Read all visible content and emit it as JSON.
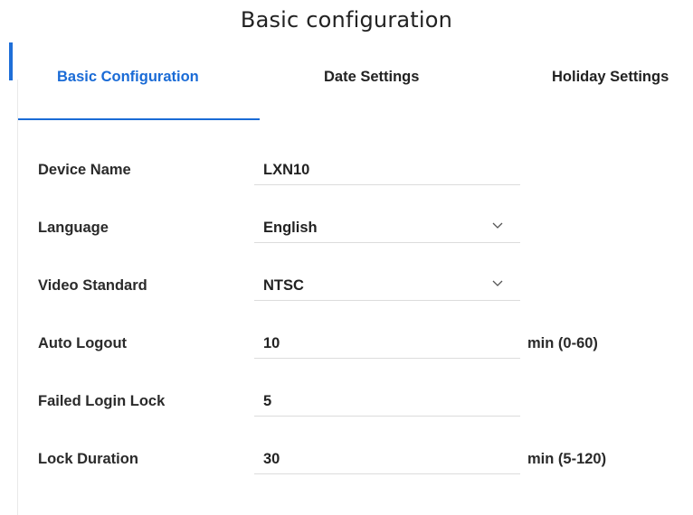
{
  "title": "Basic configuration",
  "tabs": [
    {
      "label": "Basic Configuration",
      "active": true
    },
    {
      "label": "Date Settings",
      "active": false
    },
    {
      "label": "Holiday Settings",
      "active": false
    }
  ],
  "colors": {
    "accent": "#1a6bd6",
    "text": "#222222",
    "divider": "#dcdcdc"
  },
  "form": {
    "device_name": {
      "label": "Device Name",
      "value": "LXN10"
    },
    "language": {
      "label": "Language",
      "value": "English",
      "icon": "chevron-down-icon"
    },
    "video_standard": {
      "label": "Video Standard",
      "value": "NTSC",
      "icon": "chevron-down-icon"
    },
    "auto_logout": {
      "label": "Auto Logout",
      "value": "10",
      "hint": "min (0-60)"
    },
    "failed_login_lock": {
      "label": "Failed Login Lock",
      "value": "5"
    },
    "lock_duration": {
      "label": "Lock Duration",
      "value": "30",
      "hint": "min (5-120)"
    }
  }
}
